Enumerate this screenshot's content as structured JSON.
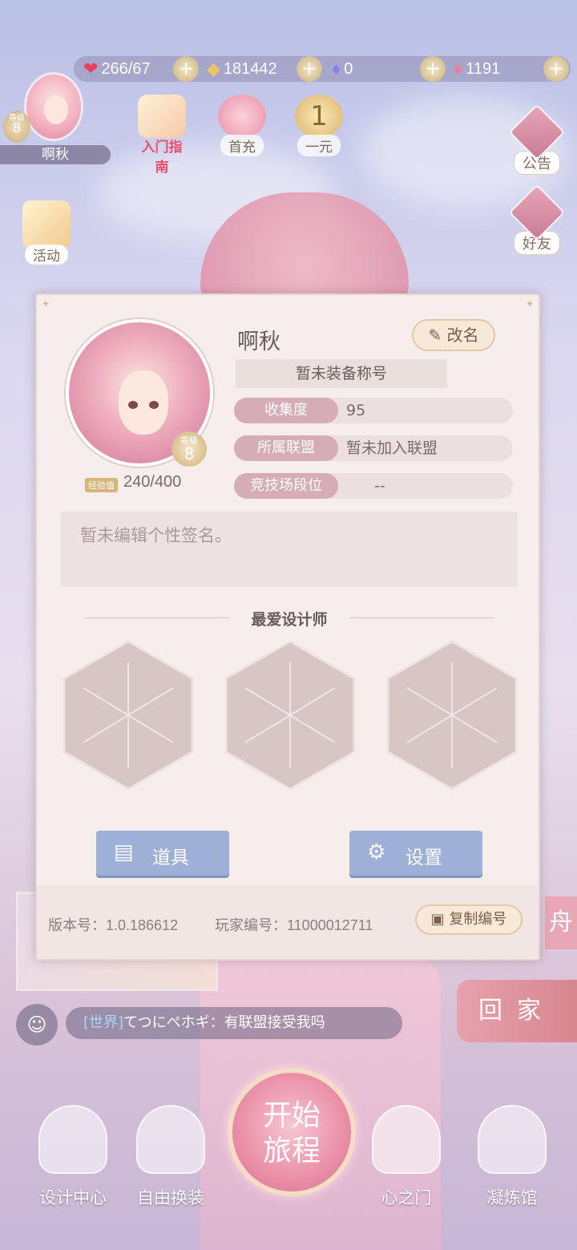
{
  "resources": {
    "stamina": "266/67",
    "gold": "181442",
    "diamond": "0",
    "pink_diamond": "1191",
    "plus": "+"
  },
  "player": {
    "name": "啊秋",
    "level_label": "等级",
    "level": "8"
  },
  "top_icons": {
    "guide": "入门指南",
    "first_charge": "首充",
    "one_yuan": "一元",
    "one_yuan_badge": "1"
  },
  "left_icons": {
    "activity": "活动"
  },
  "right_icons": {
    "notice": "公告",
    "friends": "好友"
  },
  "modal": {
    "name": "啊秋",
    "rename": "改名",
    "title_status": "暂未装备称号",
    "level_label": "等级",
    "level": "8",
    "exp_tag": "经验值",
    "exp": "240/400",
    "rows": [
      {
        "key": "收集度",
        "value": "95"
      },
      {
        "key": "所属联盟",
        "value": "暂未加入联盟"
      },
      {
        "key": "竞技场段位",
        "value": "--"
      }
    ],
    "signature": "暂未编辑个性签名。",
    "fav_title": "最爱设计师",
    "items_button": "道具",
    "settings_button": "设置",
    "version": "版本号：1.0.186612",
    "player_id": "玩家编号：11000012711",
    "copy_button": "复制编号"
  },
  "chat": {
    "channel": "[世界]",
    "message": "てつにぺホギ：有联盟接受我吗"
  },
  "home_button": "回家",
  "side_partial": "舟",
  "start_button": {
    "line1": "开始",
    "line2": "旅程"
  },
  "bottom_nav": [
    "设计中心",
    "自由换装",
    "心之门",
    "凝炼馆"
  ],
  "colors": {
    "accent": "#d6adb6",
    "button_blue": "#9fb0d6",
    "start_pink": "#ea8fa8"
  }
}
